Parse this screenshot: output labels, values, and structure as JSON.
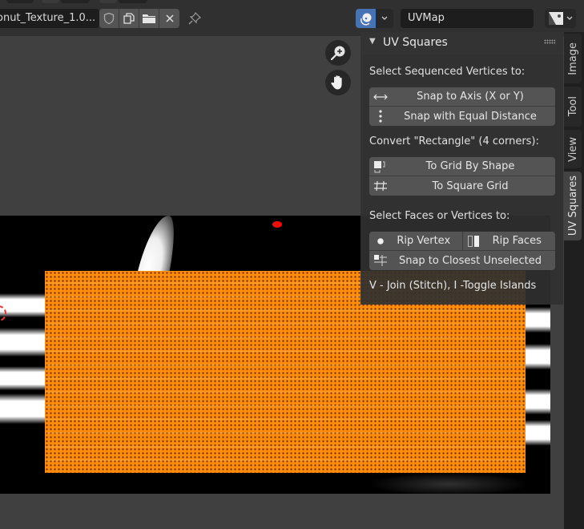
{
  "header": {
    "image_name": "onut_Texture_1.0...",
    "image_buttons": [
      {
        "icon": "fake-user-shield-icon"
      },
      {
        "icon": "duplicate-image-icon"
      },
      {
        "icon": "open-folder-icon"
      },
      {
        "icon": "close-icon"
      }
    ],
    "pin_icon": "pin-icon",
    "uv_sync_icon": "uv-sync-selection-icon",
    "uv_map": "UVMap",
    "display_channels_icon": "image-display-icon"
  },
  "viewport": {
    "nav": [
      {
        "icon": "zoom-icon"
      },
      {
        "icon": "pan-hand-icon"
      }
    ],
    "colors": {
      "uv_mesh": "#ff8c0a",
      "background": "#404040",
      "image_bg": "#000000",
      "cursor_dot": "#f20d0d"
    }
  },
  "panel": {
    "title": "UV Squares",
    "section1_label": "Select Sequenced Vertices to:",
    "snap_axis": "Snap to Axis (X or Y)",
    "snap_equal": "Snap with Equal Distance",
    "section2_label": "Convert \"Rectangle\" (4 corners):",
    "grid_by_shape": "To Grid By Shape",
    "square_grid": "To Square Grid",
    "section3_label": "Select Faces or Vertices to:",
    "rip_vertex": "Rip Vertex",
    "rip_faces": "Rip Faces",
    "snap_closest": "Snap to Closest Unselected",
    "hint": "V - Join (Stitch), I -Toggle Islands"
  },
  "tabs": [
    {
      "label": "Image",
      "active": false
    },
    {
      "label": "Tool",
      "active": false
    },
    {
      "label": "View",
      "active": false
    },
    {
      "label": "UV Squares",
      "active": true
    }
  ]
}
